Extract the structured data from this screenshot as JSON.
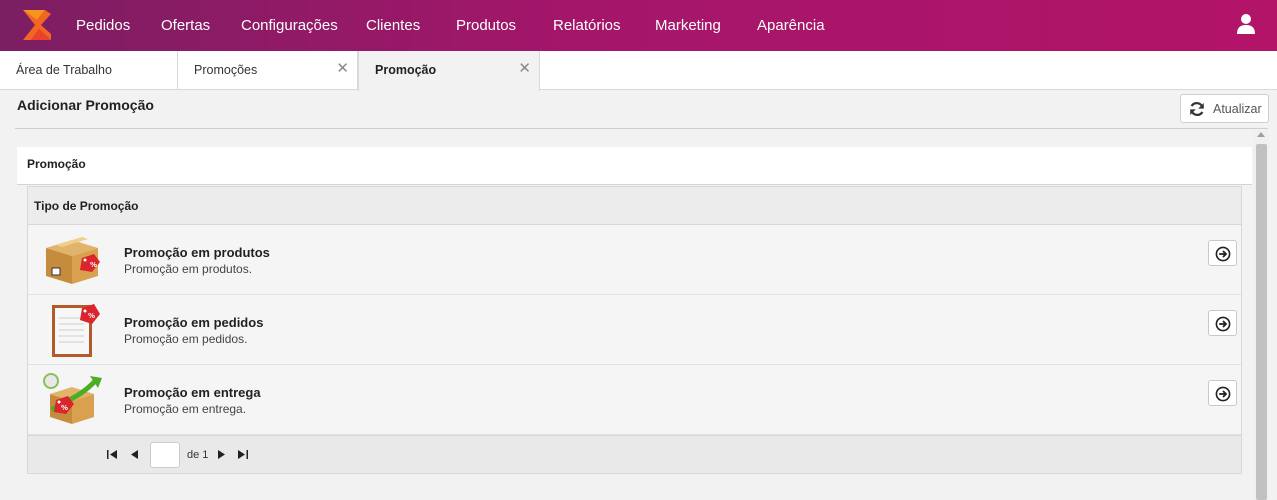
{
  "nav": {
    "items": [
      "Pedidos",
      "Ofertas",
      "Configurações",
      "Clientes",
      "Produtos",
      "Relatórios",
      "Marketing",
      "Aparência"
    ]
  },
  "tabs": [
    {
      "label": "Área de Trabalho",
      "closable": false
    },
    {
      "label": "Promoções",
      "closable": true
    },
    {
      "label": "Promoção",
      "closable": true,
      "active": true
    }
  ],
  "tab_close_glyph": "✕",
  "page": {
    "title": "Adicionar Promoção",
    "refresh_label": "Atualizar"
  },
  "section": {
    "title": "Promoção",
    "grid_header": "Tipo de Promoção",
    "rows": [
      {
        "title": "Promoção em produtos",
        "subtitle": "Promoção em produtos.",
        "icon": "product-box-tag-icon"
      },
      {
        "title": "Promoção em pedidos",
        "subtitle": "Promoção em pedidos.",
        "icon": "order-clipboard-tag-icon"
      },
      {
        "title": "Promoção em entrega",
        "subtitle": "Promoção em entrega.",
        "icon": "delivery-box-tag-icon"
      }
    ]
  },
  "pager": {
    "current_page": "",
    "of_label": "de 1"
  },
  "colors": {
    "nav_start": "#7c1e62",
    "nav_end": "#b21468",
    "logo_orange": "#f26522",
    "tag_red": "#d9252b"
  }
}
